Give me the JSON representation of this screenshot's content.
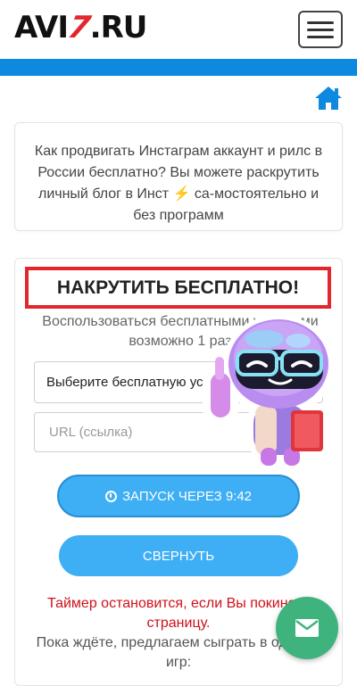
{
  "header": {
    "logo_left": "AVI",
    "logo_accent": "7",
    "logo_right": ".RU"
  },
  "intro": {
    "text": "Как продвигать Инстаграм аккаунт и рилс в России бесплатно? Вы можете раскрутить личный блог в Инст ⚡ са-мостоятельно и без программ"
  },
  "promo": {
    "title": "НАКРУТИТЬ БЕСПЛАТНО!",
    "notice": "Воспользоваться бесплатными услуга-ми возможно 1 раз"
  },
  "form": {
    "service_select": "Выберите бесплатную услугу",
    "url_placeholder": "URL (ссылка)",
    "url_value": ""
  },
  "buttons": {
    "launch_label": "ЗАПУСК ЧЕРЕЗ 9:42",
    "collapse_label": "СВЕРНУТЬ"
  },
  "messages": {
    "timer_warning": "Таймер остановится, если Вы покинете страницу.",
    "games_offer": "Пока ждёте, предлагаем сыграть в одну из игр:"
  },
  "colors": {
    "accent_blue": "#0d8ae0",
    "button_blue": "#3eaef5",
    "warning_red": "#d0101a",
    "frame_red": "#e3262e",
    "fab_green": "#3fb37d"
  },
  "icons": {
    "home": "home-icon",
    "menu": "hamburger-menu-icon",
    "clock": "clock-icon",
    "mail": "mail-icon",
    "sticker": "robot-mascot-sticker"
  }
}
